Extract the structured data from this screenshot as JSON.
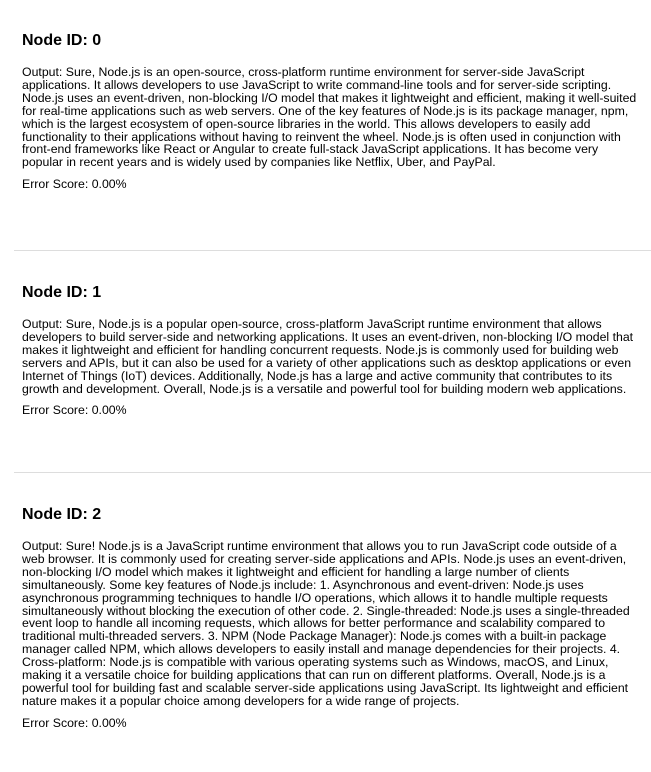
{
  "nodes": [
    {
      "title": "Node ID: 0",
      "output": "Output: Sure, Node.js is an open-source, cross-platform runtime environment for server-side JavaScript applications. It allows developers to use JavaScript to write command-line tools and for server-side scripting. Node.js uses an event-driven, non-blocking I/O model that makes it lightweight and efficient, making it well-suited for real-time applications such as web servers. One of the key features of Node.js is its package manager, npm, which is the largest ecosystem of open-source libraries in the world. This allows developers to easily add functionality to their applications without having to reinvent the wheel. Node.js is often used in conjunction with front-end frameworks like React or Angular to create full-stack JavaScript applications. It has become very popular in recent years and is widely used by companies like Netflix, Uber, and PayPal.",
      "error_score": "Error Score: 0.00%"
    },
    {
      "title": "Node ID: 1",
      "output": "Output: Sure, Node.js is a popular open-source, cross-platform JavaScript runtime environment that allows developers to build server-side and networking applications. It uses an event-driven, non-blocking I/O model that makes it lightweight and efficient for handling concurrent requests. Node.js is commonly used for building web servers and APIs, but it can also be used for a variety of other applications such as desktop applications or even Internet of Things (IoT) devices. Additionally, Node.js has a large and active community that contributes to its growth and development. Overall, Node.js is a versatile and powerful tool for building modern web applications.",
      "error_score": "Error Score: 0.00%"
    },
    {
      "title": "Node ID: 2",
      "output": "Output: Sure! Node.js is a JavaScript runtime environment that allows you to run JavaScript code outside of a web browser. It is commonly used for creating server-side applications and APIs. Node.js uses an event-driven, non-blocking I/O model which makes it lightweight and efficient for handling a large number of clients simultaneously. Some key features of Node.js include: 1. Asynchronous and event-driven: Node.js uses asynchronous programming techniques to handle I/O operations, which allows it to handle multiple requests simultaneously without blocking the execution of other code. 2. Single-threaded: Node.js uses a single-threaded event loop to handle all incoming requests, which allows for better performance and scalability compared to traditional multi-threaded servers. 3. NPM (Node Package Manager): Node.js comes with a built-in package manager called NPM, which allows developers to easily install and manage dependencies for their projects. 4. Cross-platform: Node.js is compatible with various operating systems such as Windows, macOS, and Linux, making it a versatile choice for building applications that can run on different platforms. Overall, Node.js is a powerful tool for building fast and scalable server-side applications using JavaScript. Its lightweight and efficient nature makes it a popular choice among developers for a wide range of projects.",
      "error_score": "Error Score: 0.00%"
    }
  ]
}
